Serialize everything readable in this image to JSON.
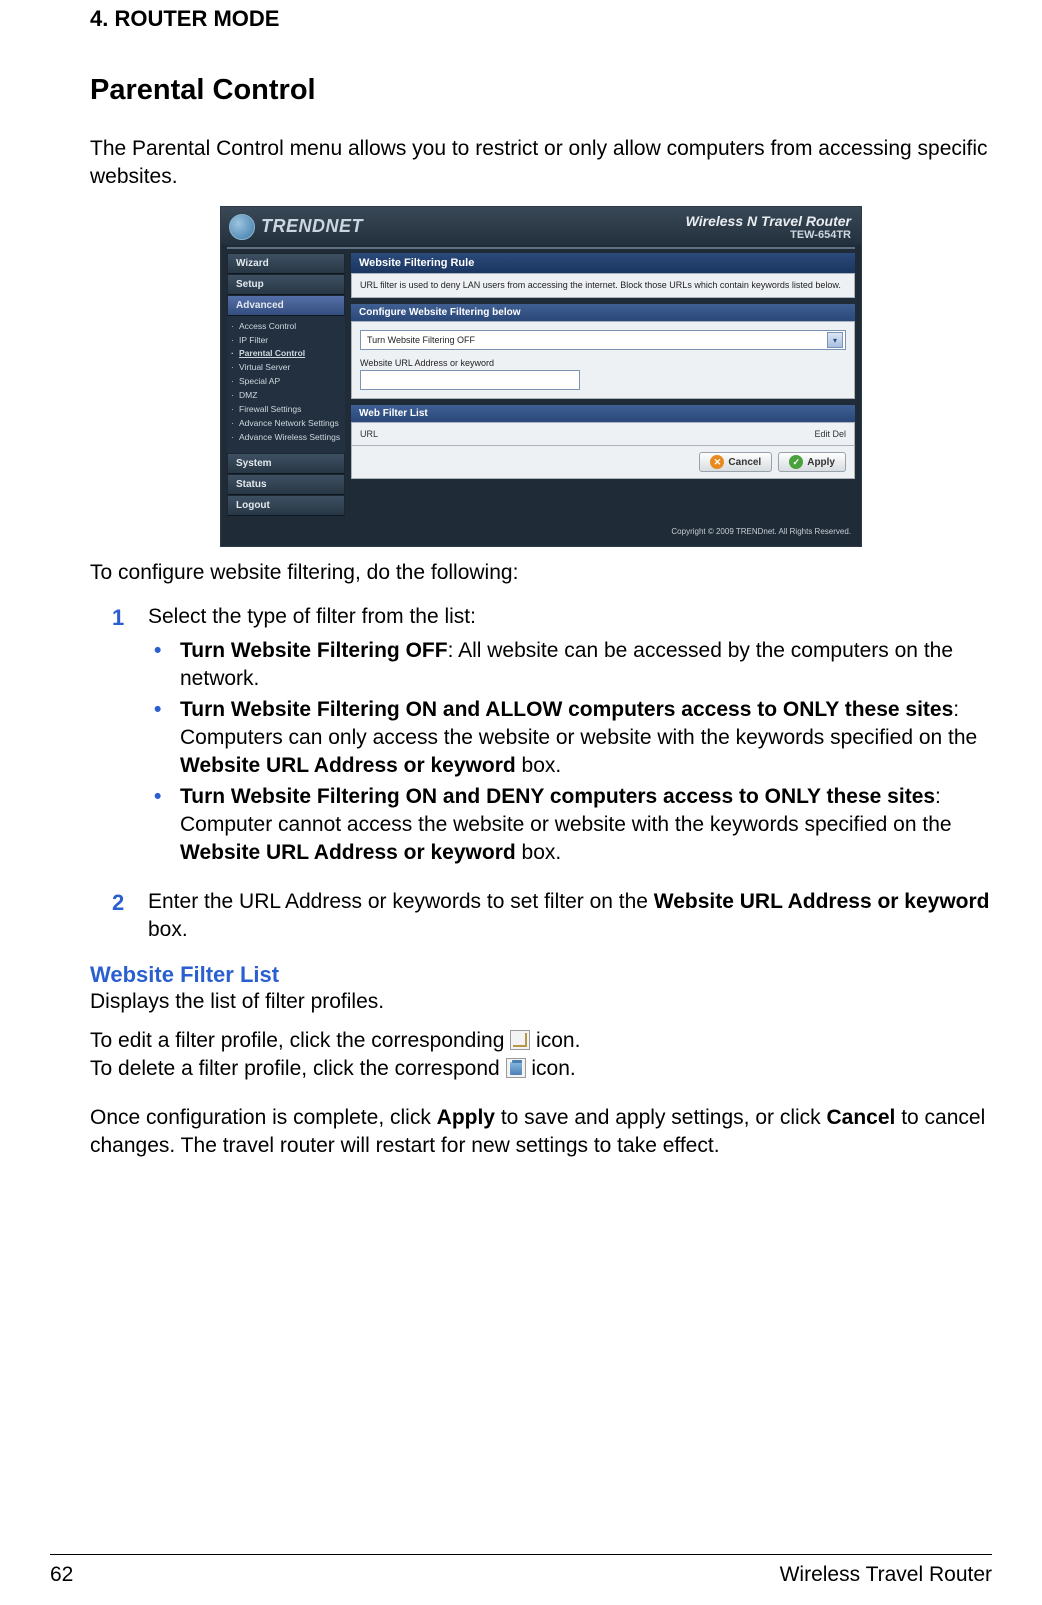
{
  "doc": {
    "chapter": "4.  ROUTER MODE",
    "section": "Parental Control",
    "intro": "The Parental Control menu allows you to restrict or only allow computers from accessing specific websites.",
    "config_line": "To configure website filtering, do the following:",
    "step1": {
      "num": "1",
      "text": "Select the type of filter from the list:",
      "b1_bold": "Turn Website Filtering OFF",
      "b1_rest": ": All website can be accessed by the computers on the network.",
      "b2_bold": "Turn Website Filtering ON and ALLOW computers access to ONLY these sites",
      "b2_rest1": ": Computers can only access the website or website with the keywords specified on the ",
      "b2_bold2": "Website URL Address or keyword",
      "b2_rest2": " box.",
      "b3_bold": "Turn Website Filtering ON and DENY computers access to ONLY these sites",
      "b3_rest1": ": Computer cannot access the website or website with the keywords specified on the ",
      "b3_bold2": "Website URL Address or keyword",
      "b3_rest2": " box."
    },
    "step2": {
      "num": "2",
      "pre": "Enter the URL Address or keywords to set filter on the ",
      "bold": "Website URL Address or keyword",
      "post": " box."
    },
    "sub_title": "Website Filter List",
    "sub_body": "Displays the list of filter profiles.",
    "edit_pre": "To edit a filter profile, click the corresponding ",
    "edit_post": " icon.",
    "delete_pre": "To delete a filter profile, click the correspond ",
    "delete_post": " icon.",
    "final_pre": "Once configuration is complete, click ",
    "final_apply": "Apply",
    "final_mid": " to save and apply settings, or click ",
    "final_cancel": "Cancel",
    "final_post": " to cancel changes. The travel router will restart for new settings to take effect."
  },
  "footer": {
    "page": "62",
    "title": "Wireless Travel Router"
  },
  "screenshot": {
    "brand": "TRENDNET",
    "product_name": "Wireless N Travel Router",
    "product_model": "TEW-654TR",
    "nav": {
      "wizard": "Wizard",
      "setup": "Setup",
      "advanced": "Advanced",
      "system": "System",
      "status": "Status",
      "logout": "Logout",
      "sub": {
        "access_control": "Access Control",
        "ip_filter": "IP Filter",
        "parental_control": "Parental Control",
        "virtual_server": "Virtual Server",
        "special_ap": "Special AP",
        "dmz": "DMZ",
        "firewall_settings": "Firewall Settings",
        "adv_network": "Advance Network Settings",
        "adv_wireless": "Advance Wireless Settings"
      }
    },
    "panel": {
      "title": "Website Filtering Rule",
      "desc": "URL filter is used to deny LAN users from accessing the internet. Block those URLs which contain keywords listed below.",
      "sec1_title": "Configure Website Filtering below",
      "combo_value": "Turn Website Filtering OFF",
      "field_label": "Website URL Address or keyword",
      "sec2_title": "Web Filter List",
      "col_url": "URL",
      "col_edit": "Edit",
      "col_del": "Del",
      "cancel": "Cancel",
      "apply": "Apply"
    },
    "copyright": "Copyright © 2009 TRENDnet. All Rights Reserved."
  }
}
